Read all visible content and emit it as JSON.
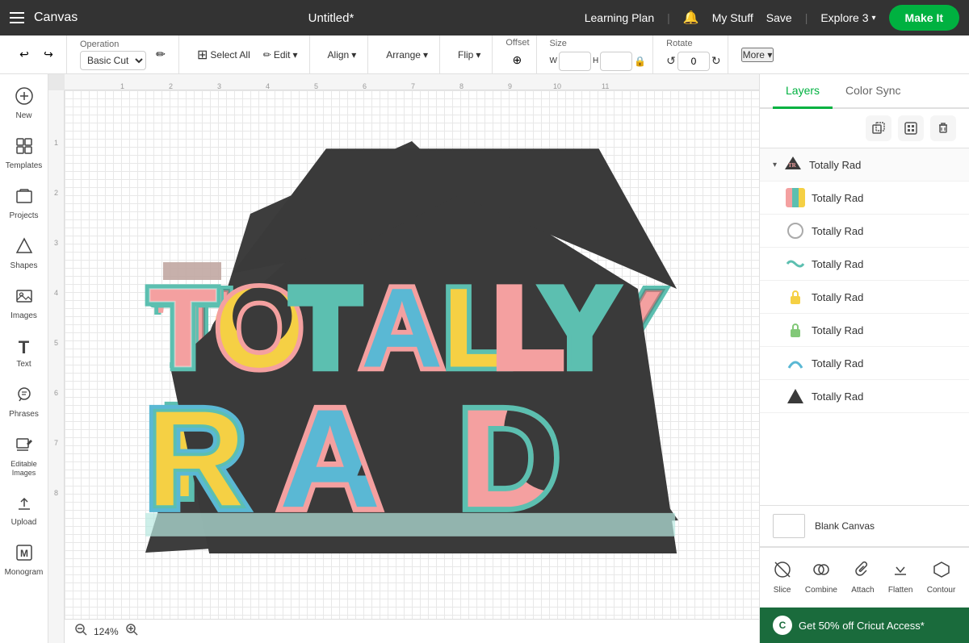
{
  "topNav": {
    "hamburger_label": "Menu",
    "canvas_label": "Canvas",
    "title": "Untitled*",
    "learning_plan": "Learning Plan",
    "notification_icon": "🔔",
    "my_stuff": "My Stuff",
    "save": "Save",
    "explore": "Explore 3",
    "make_it": "Make It"
  },
  "toolbar": {
    "undo": "↩",
    "redo": "↪",
    "operation_label": "Operation",
    "operation_value": "Basic Cut",
    "edit_icon": "✏",
    "select_all": "Select All",
    "edit": "Edit",
    "align": "Align",
    "arrange": "Arrange",
    "flip": "Flip",
    "offset": "Offset",
    "size": "Size",
    "size_w": "W",
    "size_h": "H",
    "lock_icon": "🔒",
    "rotate": "Rotate",
    "more": "More ▾"
  },
  "sidebar": {
    "items": [
      {
        "id": "new",
        "icon": "+",
        "label": "New"
      },
      {
        "id": "templates",
        "icon": "⊞",
        "label": "Templates"
      },
      {
        "id": "projects",
        "icon": "📁",
        "label": "Projects"
      },
      {
        "id": "shapes",
        "icon": "△",
        "label": "Shapes"
      },
      {
        "id": "images",
        "icon": "🖼",
        "label": "Images"
      },
      {
        "id": "text",
        "icon": "T",
        "label": "Text"
      },
      {
        "id": "phrases",
        "icon": "💬",
        "label": "Phrases"
      },
      {
        "id": "editable-images",
        "icon": "✏",
        "label": "Editable Images"
      },
      {
        "id": "upload",
        "icon": "↑",
        "label": "Upload"
      },
      {
        "id": "monogram",
        "icon": "M",
        "label": "Monogram"
      }
    ]
  },
  "rightPanel": {
    "tabs": [
      {
        "id": "layers",
        "label": "Layers",
        "active": true
      },
      {
        "id": "color-sync",
        "label": "Color Sync",
        "active": false
      }
    ],
    "panel_tools": {
      "duplicate": "⧉",
      "group": "⊟",
      "delete": "🗑"
    },
    "layers": [
      {
        "id": "group-totally-rad",
        "type": "group",
        "name": "Totally Rad",
        "icon": "🎨",
        "expanded": true,
        "color": "multi"
      },
      {
        "id": "layer-1",
        "type": "layer",
        "name": "Totally Rad",
        "icon": "text-multi",
        "color": "multi",
        "indent": true
      },
      {
        "id": "layer-2",
        "type": "layer",
        "name": "Totally Rad",
        "icon": "circle",
        "color": "gray",
        "indent": true
      },
      {
        "id": "layer-3",
        "type": "layer",
        "name": "Totally Rad",
        "icon": "wave",
        "color": "teal",
        "indent": true
      },
      {
        "id": "layer-4",
        "type": "layer",
        "name": "Totally Rad",
        "icon": "lock",
        "color": "yellow",
        "indent": true
      },
      {
        "id": "layer-5",
        "type": "layer",
        "name": "Totally Rad",
        "icon": "lock2",
        "color": "green",
        "indent": true
      },
      {
        "id": "layer-6",
        "type": "layer",
        "name": "Totally Rad",
        "icon": "arc",
        "color": "blue",
        "indent": true
      },
      {
        "id": "layer-7",
        "type": "layer",
        "name": "Totally Rad",
        "icon": "triangle-fill",
        "color": "dark",
        "indent": true
      }
    ],
    "blank_canvas_label": "Blank Canvas",
    "actions": [
      {
        "id": "slice",
        "icon": "⊘",
        "label": "Slice"
      },
      {
        "id": "combine",
        "icon": "⊕",
        "label": "Combine"
      },
      {
        "id": "attach",
        "icon": "🔗",
        "label": "Attach"
      },
      {
        "id": "flatten",
        "icon": "⬇",
        "label": "Flatten"
      },
      {
        "id": "contour",
        "icon": "⬡",
        "label": "Contour"
      }
    ]
  },
  "promo": {
    "icon": "C",
    "text": "Get 50% off Cricut Access*"
  },
  "zoom": {
    "zoom_in": "+",
    "zoom_out": "−",
    "percent": "124%"
  },
  "ruler": {
    "h_marks": [
      "1",
      "2",
      "3",
      "4",
      "5",
      "6",
      "7",
      "8",
      "9",
      "10",
      "11"
    ],
    "v_marks": [
      "1",
      "2",
      "3",
      "4",
      "5",
      "6",
      "7",
      "8"
    ]
  }
}
